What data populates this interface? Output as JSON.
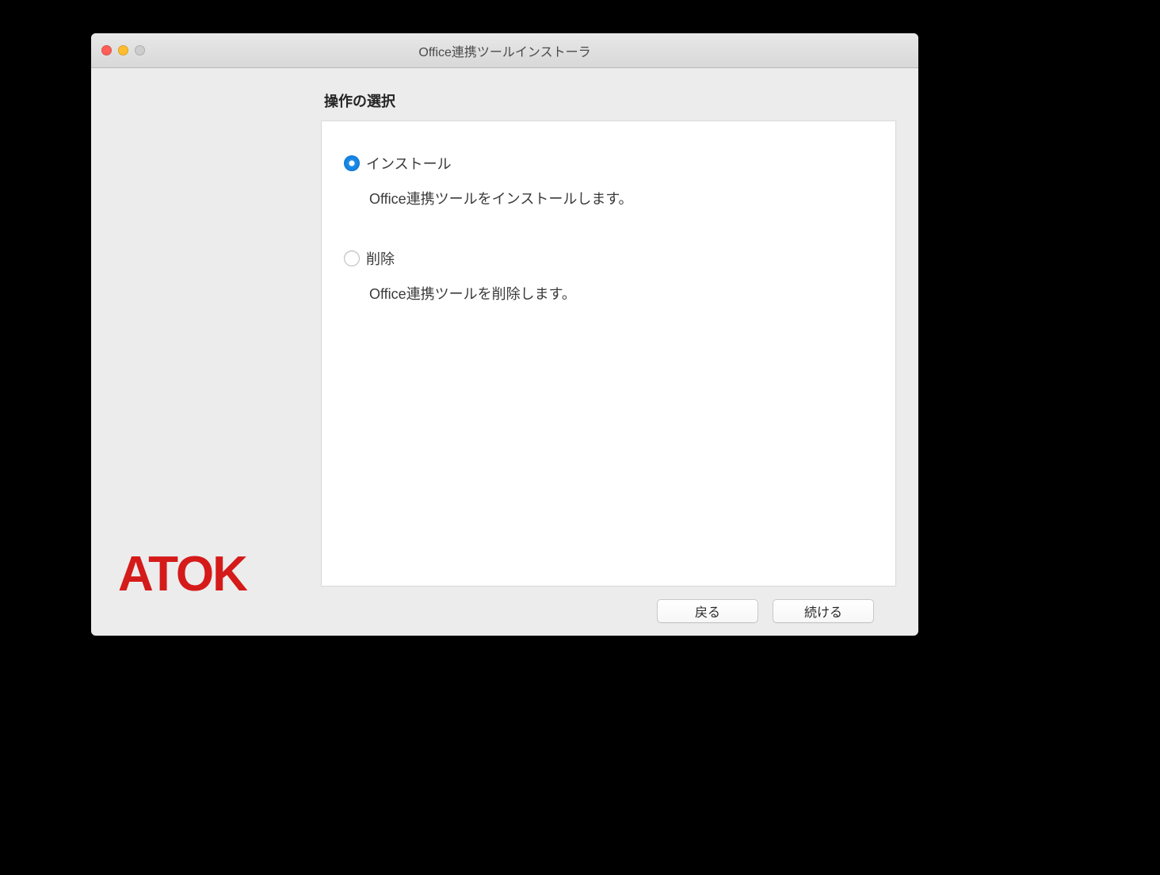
{
  "window": {
    "title": "Office連携ツールインストーラ"
  },
  "sidebar": {
    "logo_text": "ATOK"
  },
  "main": {
    "heading": "操作の選択",
    "options": [
      {
        "label": "インストール",
        "description": "Office連携ツールをインストールします。",
        "selected": true
      },
      {
        "label": "削除",
        "description": "Office連携ツールを削除します。",
        "selected": false
      }
    ]
  },
  "footer": {
    "back_label": "戻る",
    "continue_label": "続ける"
  }
}
